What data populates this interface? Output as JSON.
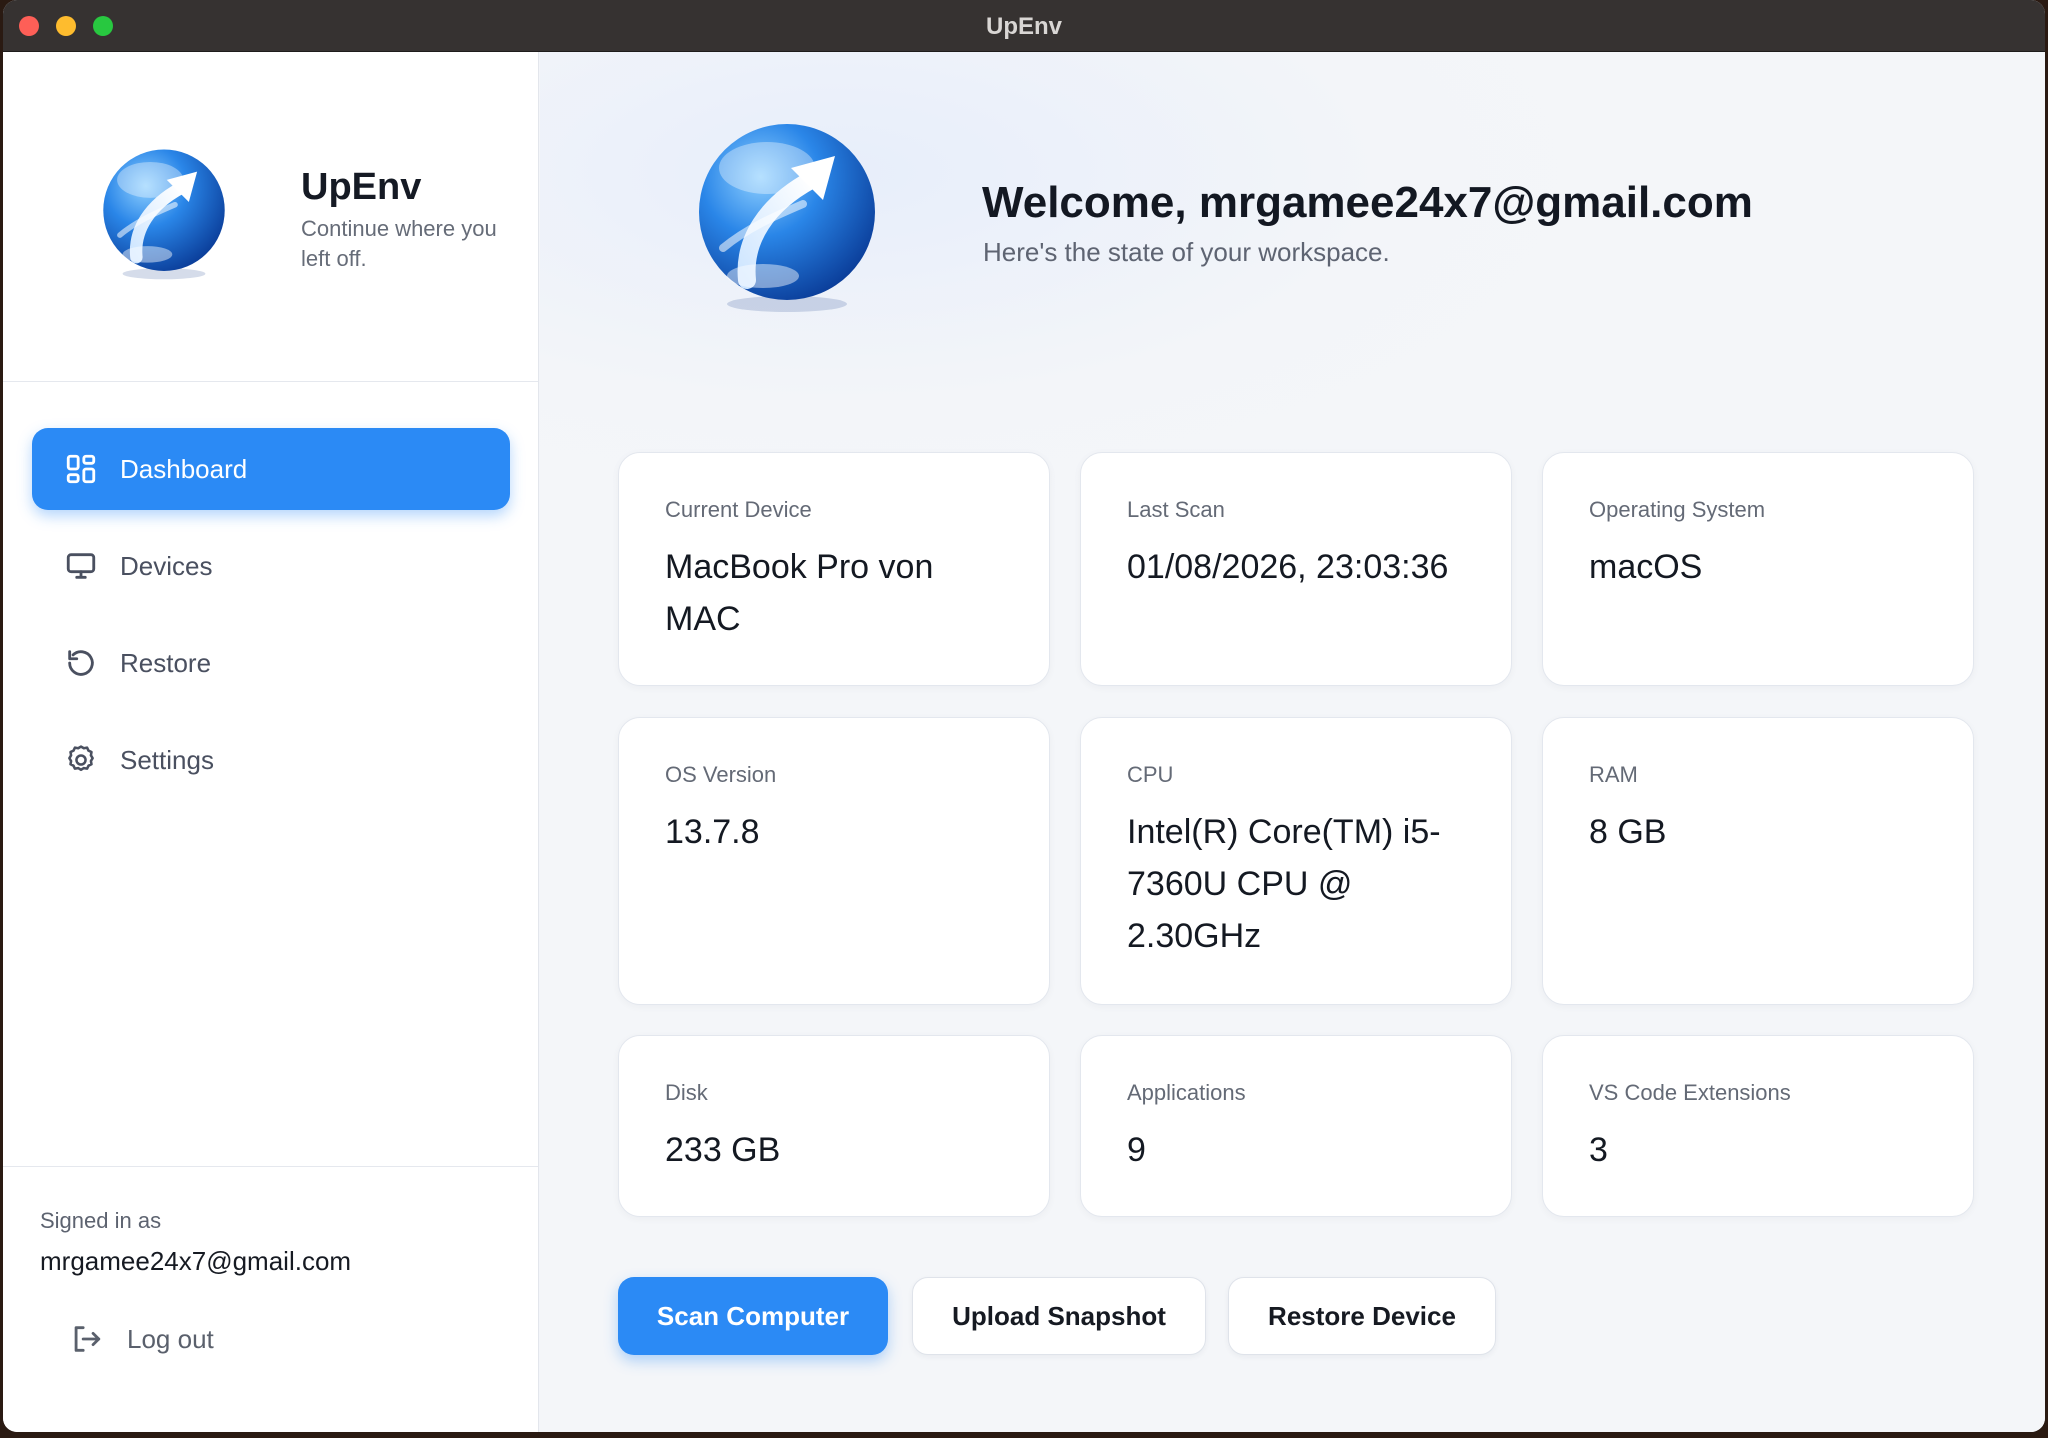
{
  "window": {
    "title": "UpEnv"
  },
  "sidebar": {
    "brand_name": "UpEnv",
    "brand_tagline": "Continue where you left off.",
    "nav": [
      {
        "label": "Dashboard",
        "icon": "grid-icon",
        "active": true
      },
      {
        "label": "Devices",
        "icon": "monitor-icon",
        "active": false
      },
      {
        "label": "Restore",
        "icon": "restore-icon",
        "active": false
      },
      {
        "label": "Settings",
        "icon": "gear-icon",
        "active": false
      }
    ],
    "signed_in_label": "Signed in as",
    "signed_in_email": "mrgamee24x7@gmail.com",
    "logout_label": "Log out"
  },
  "main": {
    "welcome": "Welcome, mrgamee24x7@gmail.com",
    "subtitle": "Here's the state of your workspace.",
    "cards": [
      {
        "label": "Current Device",
        "value": "MacBook Pro von MAC"
      },
      {
        "label": "Last Scan",
        "value": "01/08/2026, 23:03:36"
      },
      {
        "label": "Operating System",
        "value": "macOS"
      },
      {
        "label": "OS Version",
        "value": "13.7.8"
      },
      {
        "label": "CPU",
        "value": "Intel(R) Core(TM) i5-7360U CPU @ 2.30GHz"
      },
      {
        "label": "RAM",
        "value": "8 GB"
      },
      {
        "label": "Disk",
        "value": "233 GB"
      },
      {
        "label": "Applications",
        "value": "9"
      },
      {
        "label": "VS Code Extensions",
        "value": "3"
      }
    ],
    "actions": {
      "scan": "Scan Computer",
      "upload": "Upload Snapshot",
      "restore": "Restore Device"
    }
  },
  "colors": {
    "accent": "#2b8af5",
    "titlebar": "#363231",
    "background": "#f3f5f9"
  }
}
